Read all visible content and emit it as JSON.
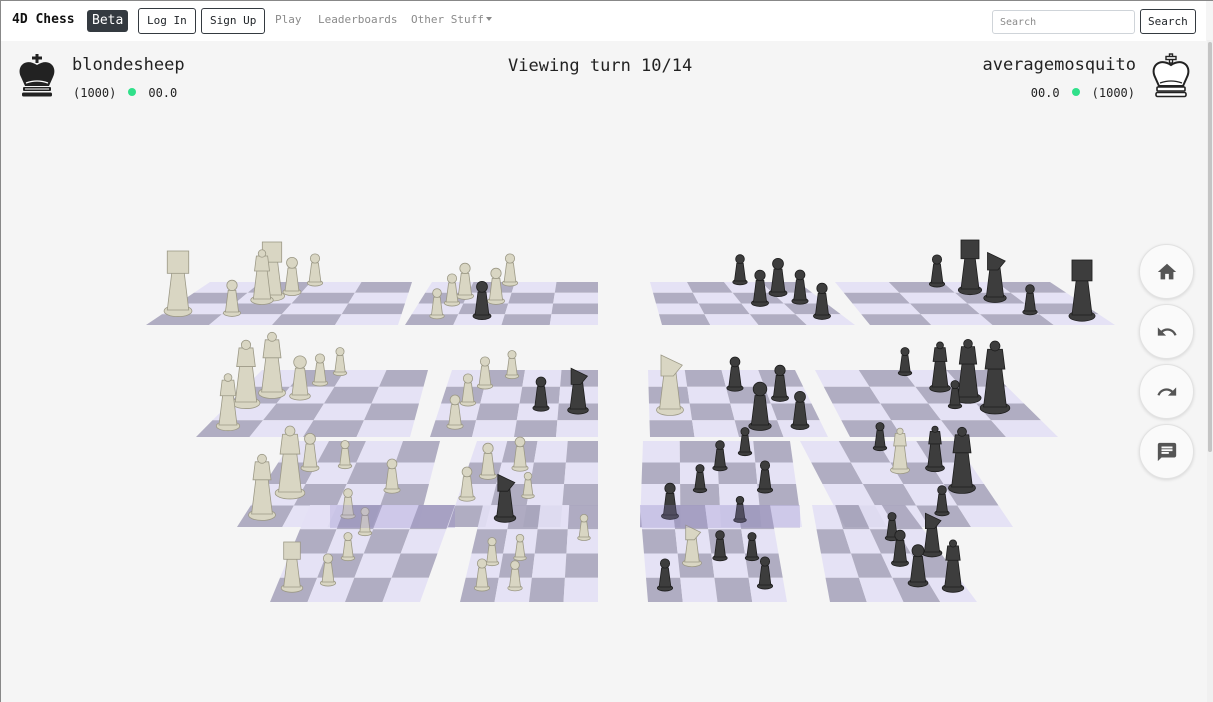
{
  "nav": {
    "brand": "4D Chess",
    "badge": "Beta",
    "login": "Log In",
    "signup": "Sign Up",
    "links": [
      "Play",
      "Leaderboards",
      "Other Stuff"
    ],
    "search_placeholder": "Search",
    "search_button": "Search"
  },
  "players": {
    "left": {
      "name": "blondesheep",
      "rating": "(1000)",
      "clock": "00.0",
      "icon": "black-king-icon"
    },
    "right": {
      "name": "averagemosquito",
      "rating": "(1000)",
      "clock": "00.0",
      "icon": "white-king-icon"
    }
  },
  "status": {
    "turn_text": "Viewing turn 10/14",
    "online_color": "#30e08a"
  },
  "controls": {
    "home": "home-icon",
    "undo": "undo-icon",
    "redo": "redo-icon",
    "chat": "chat-icon"
  },
  "colors": {
    "board_light": "#e3e0f5",
    "board_dark": "#a9a5bd",
    "white_piece": "#d9d6c3",
    "black_piece": "#3d3d3d"
  }
}
